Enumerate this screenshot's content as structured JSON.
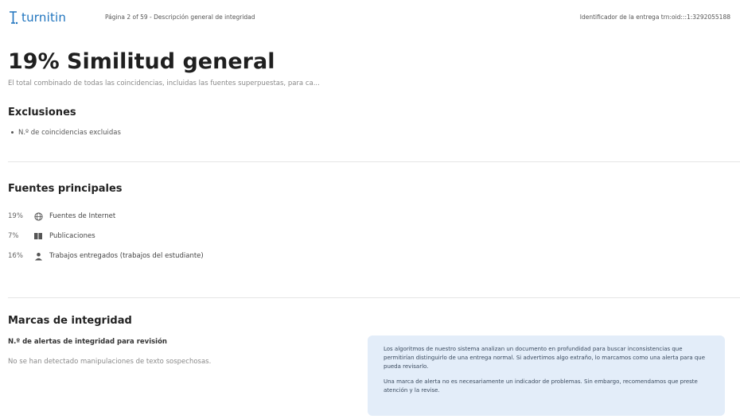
{
  "header": {
    "logo_text": "turnitin",
    "page_info": "Página 2 of 59 - Descripción general de integridad",
    "submission_id": "Identificador de la entrega trn:oid:::1:3292055188"
  },
  "summary": {
    "title": "19% Similitud general",
    "subtitle": "El total combinado de todas las coincidencias, incluidas las fuentes superpuestas, para ca..."
  },
  "exclusions": {
    "heading": "Exclusiones",
    "items": [
      "N.º de coincidencias excluidas"
    ]
  },
  "top_sources": {
    "heading": "Fuentes principales",
    "rows": [
      {
        "percent": "19%",
        "icon": "globe-icon",
        "label": "Fuentes de Internet"
      },
      {
        "percent": "7%",
        "icon": "book-icon",
        "label": "Publicaciones"
      },
      {
        "percent": "16%",
        "icon": "person-icon",
        "label": "Trabajos entregados (trabajos del estudiante)"
      }
    ]
  },
  "integrity": {
    "heading": "Marcas de integridad",
    "subheading": "N.º de alertas de integridad para revisión",
    "none_text": "No se han detectado manipulaciones de texto sospechosas.",
    "info_paragraphs": [
      "Los algoritmos de nuestro sistema analizan un documento en profundidad para buscar inconsistencias que permitirían distinguirlo de una entrega normal. Si advertimos algo extraño, lo marcamos como una alerta para que pueda revisarlo.",
      "Una marca de alerta no es necesariamente un indicador de problemas. Sin embargo, recomendamos que preste atención y la revise."
    ]
  },
  "colors": {
    "brand": "#1e73be",
    "info_box_bg": "#e3edf9"
  }
}
